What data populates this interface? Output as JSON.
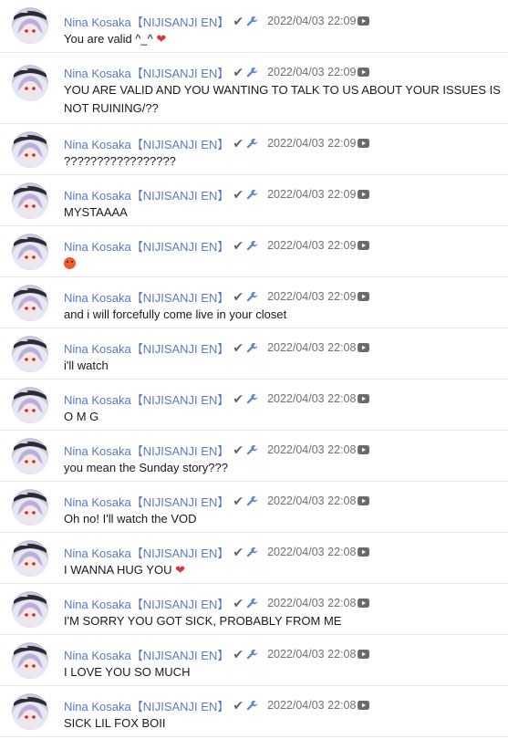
{
  "chat": {
    "author": "Nina Kosaka【NIJISANJI EN】",
    "badges": [
      "moderator-check-icon",
      "moderator-wrench-icon"
    ],
    "messages": [
      {
        "time": "2022/04/03 22:09",
        "text": "You are valid ^_^",
        "emoji": "heart"
      },
      {
        "time": "2022/04/03 22:09",
        "text": "YOU ARE VALID AND YOU WANTING TO TALK TO US ABOUT YOUR ISSUES IS NOT RUINING/??",
        "emoji": ""
      },
      {
        "time": "2022/04/03 22:09",
        "text": "?????????????????",
        "emoji": ""
      },
      {
        "time": "2022/04/03 22:09",
        "text": "MYSTAAAA",
        "emoji": ""
      },
      {
        "time": "2022/04/03 22:09",
        "text": "",
        "emoji": "angry"
      },
      {
        "time": "2022/04/03 22:09",
        "text": "and i will forcefully come live in your closet",
        "emoji": ""
      },
      {
        "time": "2022/04/03 22:08",
        "text": "i'll watch",
        "emoji": ""
      },
      {
        "time": "2022/04/03 22:08",
        "text": "O M G",
        "emoji": ""
      },
      {
        "time": "2022/04/03 22:08",
        "text": "you mean the Sunday story???",
        "emoji": ""
      },
      {
        "time": "2022/04/03 22:08",
        "text": "Oh no! I'll watch the VOD",
        "emoji": ""
      },
      {
        "time": "2022/04/03 22:08",
        "text": "I WANNA HUG YOU",
        "emoji": "heart"
      },
      {
        "time": "2022/04/03 22:08",
        "text": "I'M SORRY YOU GOT SICK, PROBABLY FROM ME",
        "emoji": ""
      },
      {
        "time": "2022/04/03 22:08",
        "text": "I LOVE YOU SO MUCH",
        "emoji": ""
      },
      {
        "time": "2022/04/03 22:08",
        "text": "SICK LIL FOX BOII",
        "emoji": ""
      }
    ]
  }
}
